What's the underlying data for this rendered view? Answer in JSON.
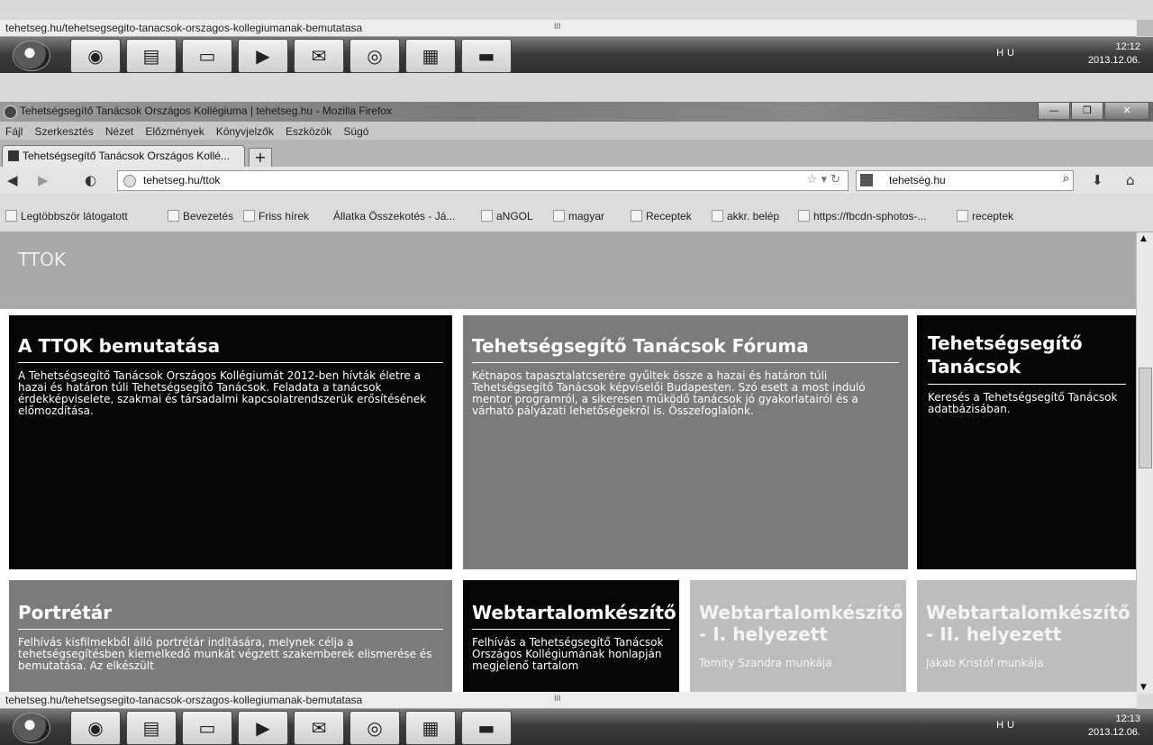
{
  "top_status": {
    "url": "tehetseg.hu/tehetsegsegito-tanacsok-orszagos-kollegiumanak-bemutatasa",
    "mark": "III"
  },
  "top_taskbar": {
    "tray_lang": "HU",
    "time": "12:12",
    "date": "2013.12.06."
  },
  "window": {
    "title": "Tehetségsegítő Tanácsok Országos Kollégiuma | tehetseg.hu - Mozilla Firefox"
  },
  "menu": [
    "Fájl",
    "Szerkesztés",
    "Nézet",
    "Előzmények",
    "Könyvjelzők",
    "Eszközök",
    "Súgó"
  ],
  "tab": {
    "label": "Tehetségsegítő Tanácsok Országos Kollé...",
    "close": "×",
    "new": "+"
  },
  "nav": {
    "url": "tehetseg.hu/ttok",
    "search_engine_text": "tehetség.hu"
  },
  "bookmarks": [
    "Legtöbbször látogatott",
    "Bevezetés",
    "Friss hírek",
    "Állatka Összekotés - Já...",
    "aNGOL",
    "magyar",
    "Receptek",
    "akkr. belép",
    "https://fbcdn-sphotos-...",
    "receptek"
  ],
  "page": {
    "banner_title": "TTOK",
    "cards": [
      {
        "title": "A TTOK bemutatása",
        "text": "A Tehetségsegítő Tanácsok Országos Kollégiumát 2012-ben hívták életre a hazai és határon túli Tehetségsegítő Tanácsok. Feladata a tanácsok érdekképviselete, szakmai és társadalmi kapcsolatrendszerük erősítésének előmozdítása."
      },
      {
        "title": "Tehetségsegítő Tanácsok Fóruma",
        "text": "Kétnapos tapasztalatcserére gyűltek össze a hazai és határon túli Tehetségsegítő Tanácsok képviselői Budapesten. Szó esett a most induló mentor programról, a sikeresen működő tanácsok jó gyakorlatairól és a várható pályázati lehetőségekről is. Összefoglalónk."
      },
      {
        "title": "Tehetségsegítő Tanácsok",
        "text": "Keresés a Tehetségsegítő Tanácsok adatbázisában."
      },
      {
        "title": "Portrétár",
        "text": "Felhívás kisfilmekből álló portrétár indítására, melynek célja a tehetségsegítésben kiemelkedő munkát végzett szakemberek elismerése és bemutatása. Az elkészült"
      },
      {
        "title": "Webtartalomkészítő",
        "text": "Felhívás a Tehetségsegítő Tanácsok Országos Kollégiumának honlapján megjelenő tartalom"
      },
      {
        "title": "Webtartalomkészítő - I. helyezett",
        "text": "Tomity Szandra munkája"
      },
      {
        "title": "Webtartalomkészítő - II. helyezett",
        "text": "Jakab Kristóf munkája"
      }
    ]
  },
  "bottom_status": {
    "url": "tehetseg.hu/tehetsegsegito-tanacsok-orszagos-kollegiumanak-bemutatasa",
    "mark": "III"
  },
  "bottom_taskbar": {
    "tray_lang": "HU",
    "time": "12:13",
    "date": "2013.12.06."
  }
}
